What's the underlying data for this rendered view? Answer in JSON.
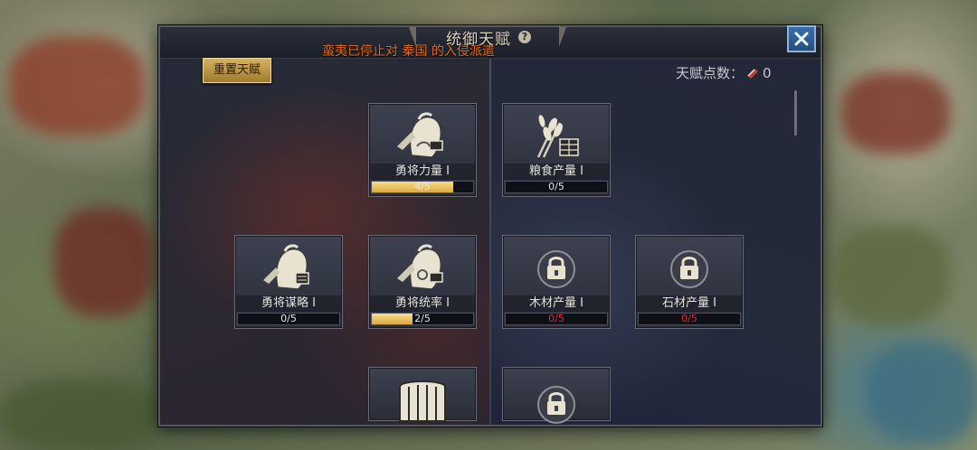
{
  "panel": {
    "title": "统御天赋",
    "marquee": "蛮夷已停止对 秦国 的入侵派遣",
    "reset_label": "重置天赋",
    "points_label": "天赋点数：",
    "points_value": "0"
  },
  "nodes": [
    {
      "name": "勇将力量 I",
      "progress": "4/5",
      "level": 0.8,
      "icon": "general-bag-icon"
    },
    {
      "name": "粮食产量 I",
      "progress": "0/5",
      "level": 0.0,
      "icon": "wheat-icon"
    },
    {
      "name": "勇将谋略 I",
      "progress": "0/5",
      "level": 0.0,
      "icon": "general-bag-icon"
    },
    {
      "name": "勇将统率 I",
      "progress": "2/5",
      "level": 0.4,
      "icon": "general-bag-icon"
    },
    {
      "name": "木材产量 I",
      "progress": "0/5",
      "level": 0.0,
      "icon": "lock-icon",
      "locked": true
    },
    {
      "name": "石材产量 I",
      "progress": "0/5",
      "level": 0.0,
      "icon": "lock-icon",
      "locked": true
    }
  ],
  "colors": {
    "progress_fill": "#e7c05a",
    "locked_text": "#e12b2b",
    "marquee": "#e06a1a",
    "close_button": "#2f6398"
  }
}
